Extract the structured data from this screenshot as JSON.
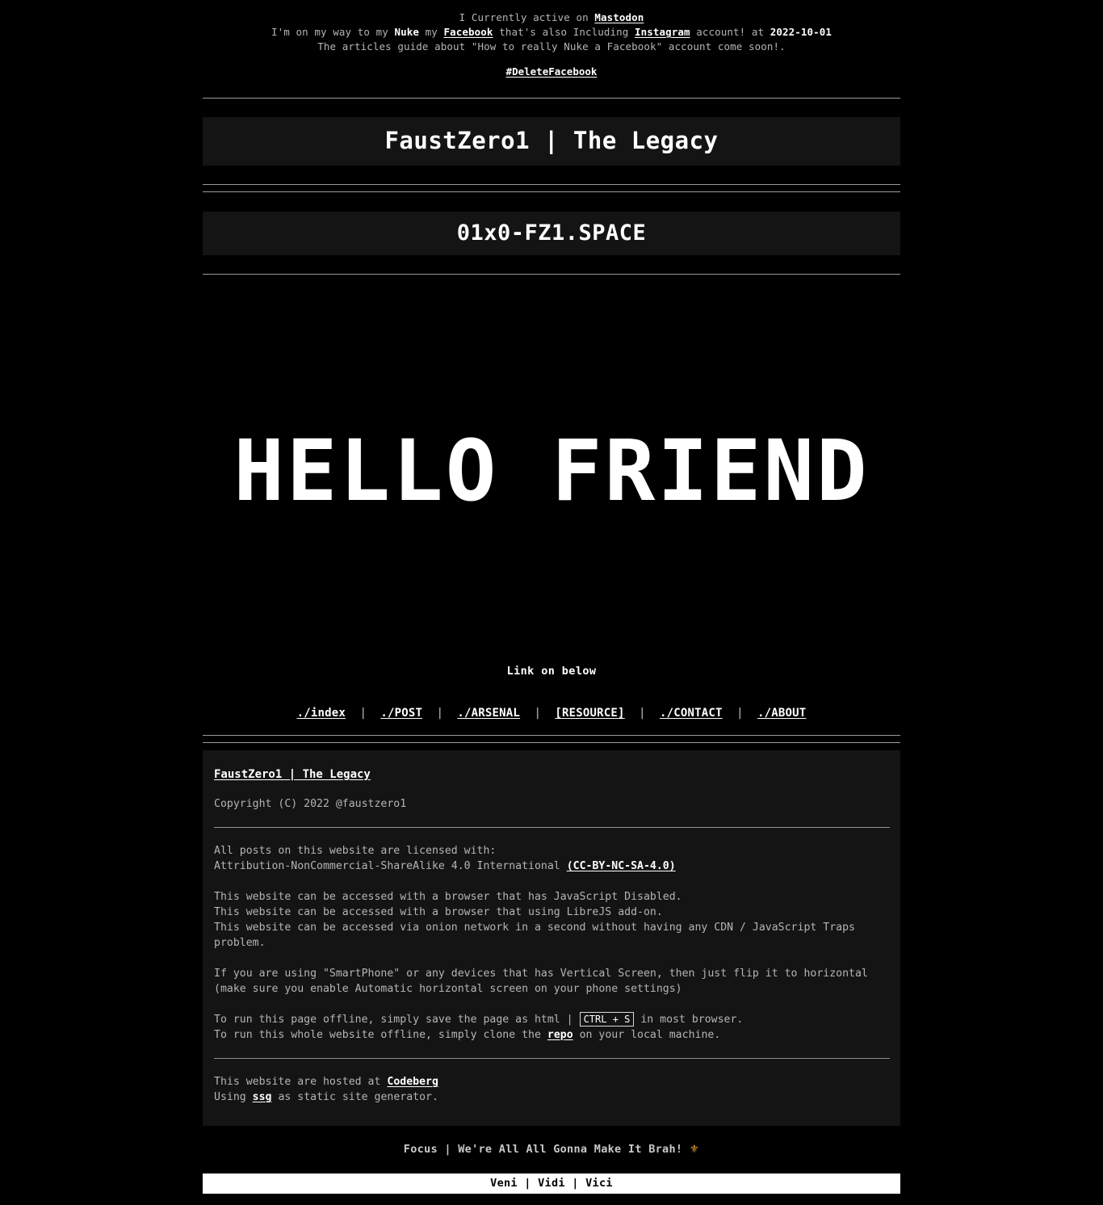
{
  "announcement": {
    "line1_pre": "I Currently active on",
    "line1_link": "Mastodon",
    "line2_a": "I'm on my way to my",
    "line2_b": "Nuke",
    "line2_c": "my",
    "line2_link1": "Facebook",
    "line2_d": "that's also Including",
    "line2_link2": "Instagram",
    "line2_e": "account! at",
    "line2_date": "2022-10-01",
    "line3": "The articles guide about \"How to really Nuke a Facebook\" account come soon!.",
    "hashtag": "#DeleteFacebook"
  },
  "header": {
    "site_title": "FaustZero1 | The Legacy",
    "domain_banner": "01x0-FZ1.SPACE"
  },
  "hero": {
    "heading": "HELLO FRIEND"
  },
  "nav": {
    "caption": "Link on below",
    "separator": "|",
    "items": [
      {
        "label": "./index"
      },
      {
        "label": "./POST"
      },
      {
        "label": "./ARSENAL"
      },
      {
        "label": "[RESOURCE]"
      },
      {
        "label": "./CONTACT"
      },
      {
        "label": "./ABOUT"
      }
    ]
  },
  "footer": {
    "title": "FaustZero1 | The Legacy",
    "copyright": "Copyright (C) 2022 @faustzero1",
    "license_line1": "All posts on this website are licensed with:",
    "license_line2_text": "Attribution-NonCommercial-ShareAlike 4.0 International",
    "license_link": "(CC-BY-NC-SA-4.0)",
    "access_line1": "This website can be accessed with a browser that has JavaScript Disabled.",
    "access_line2": "This website can be accessed with a browser that using LibreJS add-on.",
    "access_line3": "This website can be accessed via onion network in a second without having any CDN / JavaScript Traps problem.",
    "smartphone_note": "If you are using \"SmartPhone\" or any devices that has Vertical Screen, then just flip it to horizontal (make sure you enable Automatic horizontal screen on your phone settings)",
    "offline_page_pre": "To run this page offline, simply save the page as html |",
    "offline_kbd": "CTRL + S",
    "offline_page_post": "in most browser.",
    "offline_site_pre": "To run this whole website offline, simply clone the",
    "offline_site_link": "repo",
    "offline_site_post": "on your local machine.",
    "hosted_pre": "This website are hosted at",
    "hosted_link": "Codeberg",
    "ssg_pre": "Using",
    "ssg_link": "ssg",
    "ssg_post": "as static site generator."
  },
  "bottom": {
    "focus_text": "Focus | We're All All Gonna Make It Brah!",
    "focus_emoji": "⚜",
    "motto": "Veni | Vidi | Vici"
  },
  "colors": {
    "background": "#000000",
    "panel": "#141414",
    "text": "#b5b5b5",
    "accent_text": "#ffffff",
    "rule": "#9a9a9a",
    "emoji_gold": "#e8a020",
    "bottom_bar_bg": "#ffffff",
    "bottom_bar_text": "#000000"
  }
}
